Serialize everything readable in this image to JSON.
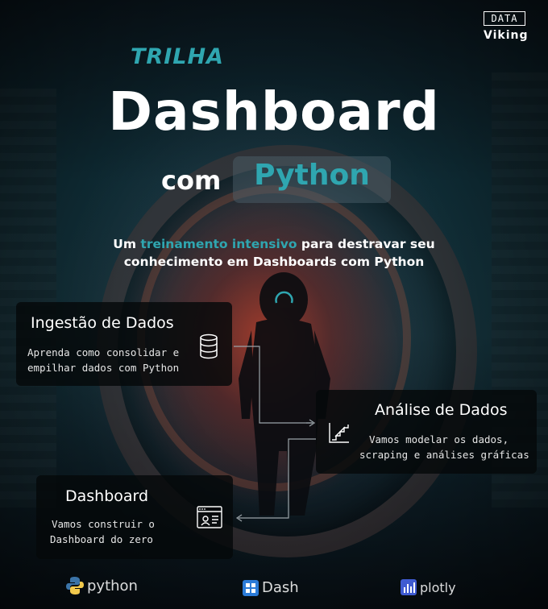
{
  "brand": {
    "box_text": "DATA",
    "word_text": "Viking"
  },
  "hero": {
    "eyebrow": "TRILHA",
    "title": "Dashboard",
    "connector": "com",
    "highlight": "Python"
  },
  "subtitle": {
    "part1": "Um ",
    "highlight": "treinamento intensivo",
    "part2": " para destravar seu",
    "line2": "conhecimento em Dashboards com Python"
  },
  "steps": [
    {
      "title": "Ingestão de Dados",
      "desc_line1": "Aprenda como consolidar e",
      "desc_line2": "empilhar dados com Python",
      "icon": "database-icon"
    },
    {
      "title": "Análise de Dados",
      "desc_line1": "Vamos modelar os dados,",
      "desc_line2": "scraping e análises gráficas",
      "icon": "chart-stairs-icon"
    },
    {
      "title": "Dashboard",
      "desc_line1": "Vamos construir o",
      "desc_line2": "Dashboard do zero",
      "icon": "dashboard-window-icon"
    }
  ],
  "tools": [
    {
      "label": "python",
      "icon": "python-logo-icon"
    },
    {
      "label": "Dash",
      "icon": "dash-logo-icon"
    },
    {
      "label": "plotly",
      "icon": "plotly-logo-icon"
    }
  ],
  "colors": {
    "accent": "#2fa6b0",
    "text": "#ffffff",
    "card_bg": "#05080a"
  }
}
